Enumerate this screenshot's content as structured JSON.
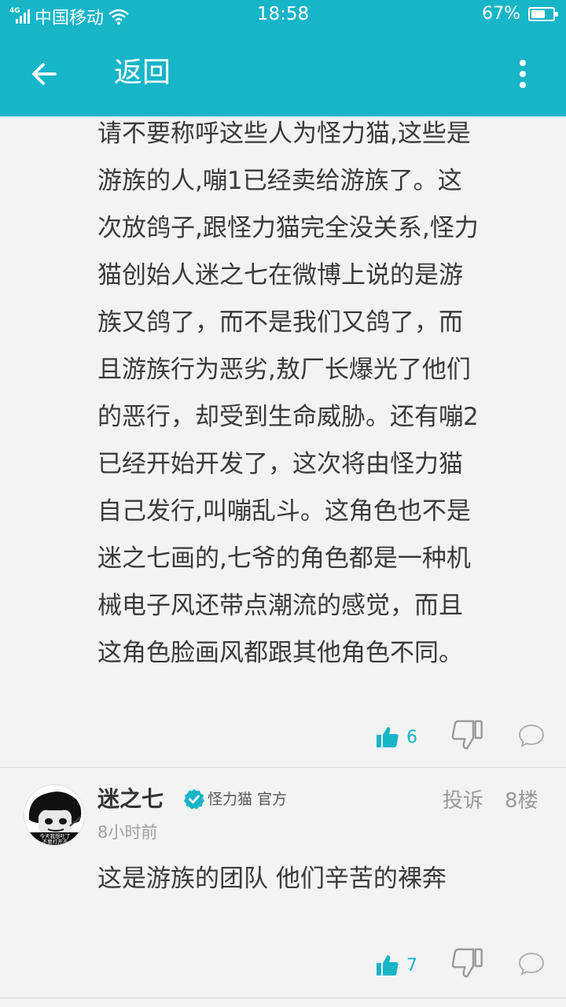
{
  "status_bar": {
    "network_type": "4G",
    "carrier": "中国移动",
    "time": "18:58",
    "battery_text": "67%",
    "battery_level": 0.67
  },
  "header": {
    "back_icon": "arrow-left-icon",
    "title": "返回",
    "more_icon": "more-vertical-icon"
  },
  "comments": [
    {
      "text": "请不要称呼这些人为怪力猫,这些是\n游族的人,嘣1已经卖给游族了。这\n次放鸽子,跟怪力猫完全没关系,怪力\n猫创始人迷之七在微博上说的是游\n族又鸽了，而不是我们又鸽了，而\n且游族行为恶劣,敖厂长爆光了他们\n的恶行，却受到生命威胁。还有嘣2\n已经开始开发了，这次将由怪力猫\n自己发行,叫嘣乱斗。这角色也不是\n迷之七画的,七爷的角色都是一种机\n械电子风还带点潮流的感觉，而且\n这角色脸画风都跟其他角色不同。",
      "likes": "6"
    },
    {
      "username": "迷之七",
      "badge": "怪力猫 官方",
      "report_label": "投诉",
      "floor": "8楼",
      "time_ago": "8小时前",
      "text": "这是游族的团队 他们辛苦的裸奔",
      "likes": "7",
      "avatar_caption_1": "今天我想吐了",
      "avatar_caption_2": "不要打开不"
    }
  ],
  "colors": {
    "accent": "#17b5c8",
    "background": "#f3f3f3",
    "text": "#3a3a3a",
    "muted": "#9a9a9a"
  }
}
